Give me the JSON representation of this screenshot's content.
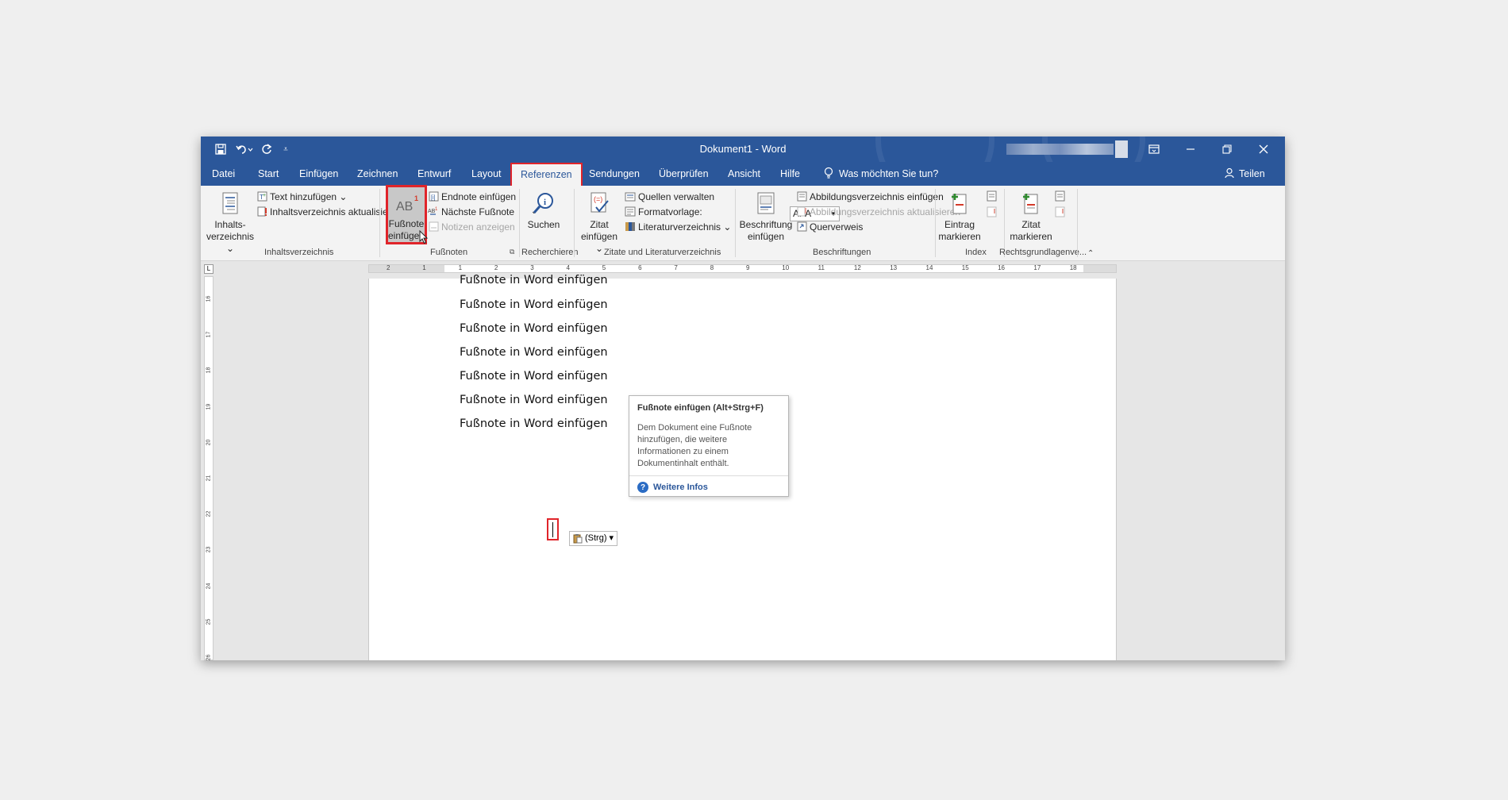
{
  "window": {
    "title": "Dokument1  -  Word",
    "qat": {
      "save_icon": "save-icon",
      "undo_icon": "undo-icon",
      "redo_icon": "redo-icon",
      "customize_icon": "customize-qat-icon"
    },
    "controls": {
      "display_options": "ribbon-display-icon",
      "minimize": "minimize-icon",
      "restore": "restore-icon",
      "close": "close-icon"
    }
  },
  "tabs": {
    "datei": "Datei",
    "start": "Start",
    "einfuegen": "Einfügen",
    "zeichnen": "Zeichnen",
    "entwurf": "Entwurf",
    "layout": "Layout",
    "referenzen": "Referenzen",
    "sendungen": "Sendungen",
    "ueberpruefen": "Überprüfen",
    "ansicht": "Ansicht",
    "hilfe": "Hilfe",
    "tell_me": "Was möchten Sie tun?",
    "share": "Teilen"
  },
  "ribbon": {
    "toc": {
      "big_button": [
        "Inhalts-",
        "verzeichnis ⌄"
      ],
      "add_text": "Text hinzufügen ⌄",
      "update": "Inhaltsverzeichnis aktualisieren",
      "label": "Inhaltsverzeichnis"
    },
    "footnotes": {
      "insert_footnote": [
        "Fußnote",
        "einfügen"
      ],
      "insert_endnote": "Endnote einfügen",
      "next_footnote": "Nächste Fußnote",
      "show_notes": "Notizen anzeigen",
      "label": "Fußnoten"
    },
    "research": {
      "search": "Suchen",
      "label": "Recherchieren"
    },
    "citations": {
      "insert_citation": [
        "Zitat",
        "einfügen ⌄"
      ],
      "manage_sources": "Quellen verwalten",
      "style_label": "Formatvorlage:",
      "style_value": "APA",
      "bibliography": "Literaturverzeichnis ⌄",
      "label": "Zitate und Literaturverzeichnis"
    },
    "captions": {
      "insert_caption": [
        "Beschriftung",
        "einfügen"
      ],
      "insert_table_of_figures": "Abbildungsverzeichnis einfügen",
      "update_table": "Abbildungsverzeichnis aktualisieren",
      "cross_reference": "Querverweis",
      "label": "Beschriftungen"
    },
    "index": {
      "mark_entry": [
        "Eintrag",
        "markieren"
      ],
      "label": "Index"
    },
    "authorities": {
      "mark_citation": [
        "Zitat",
        "markieren"
      ],
      "label": "Rechtsgrundlagenve..."
    }
  },
  "ruler": {
    "h_ticks": [
      "2",
      "1",
      "1",
      "2",
      "3",
      "4",
      "5",
      "6",
      "7",
      "8",
      "9",
      "10",
      "11",
      "12",
      "13",
      "14",
      "15",
      "16",
      "17",
      "18"
    ],
    "v_ticks": [
      "16",
      "17",
      "18",
      "19",
      "20",
      "21",
      "22",
      "23",
      "24",
      "25",
      "26"
    ]
  },
  "document": {
    "lines": [
      "Fußnote in Word einfügen",
      "Fußnote in Word einfügen",
      "Fußnote in Word einfügen",
      "Fußnote in Word einfügen",
      "Fußnote in Word einfügen",
      "Fußnote in Word einfügen",
      "Fußnote in Word einfügen"
    ],
    "paste_options": "(Strg) ▾"
  },
  "tooltip": {
    "title": "Fußnote einfügen (Alt+Strg+F)",
    "description": "Dem Dokument eine Fußnote hinzufügen, die weitere Informationen zu einem Dokumentinhalt enthält.",
    "more": "Weitere Infos"
  },
  "colors": {
    "word_blue": "#2b579a",
    "highlight_red": "#e0242a",
    "ribbon_bg": "#f3f3f3"
  }
}
